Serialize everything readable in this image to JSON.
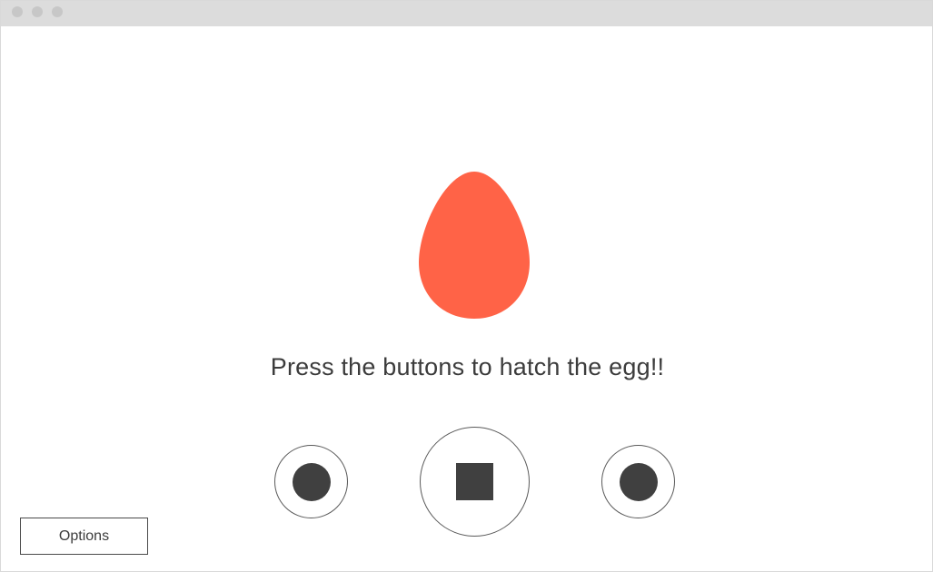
{
  "window": {
    "title_bar_dots": [
      "close-dot",
      "minimize-dot",
      "maximize-dot"
    ]
  },
  "egg": {
    "color": "#ff6347",
    "icon": "egg-icon"
  },
  "message": "Press the buttons to hatch the egg!!",
  "controls": {
    "left": {
      "icon": "circle-icon"
    },
    "center": {
      "icon": "square-icon"
    },
    "right": {
      "icon": "circle-icon"
    }
  },
  "options_label": "Options",
  "colors": {
    "egg": "#ff6347",
    "button_glyph": "#404040",
    "title_bar": "#dcdcdc",
    "text": "#3c3c3c"
  }
}
